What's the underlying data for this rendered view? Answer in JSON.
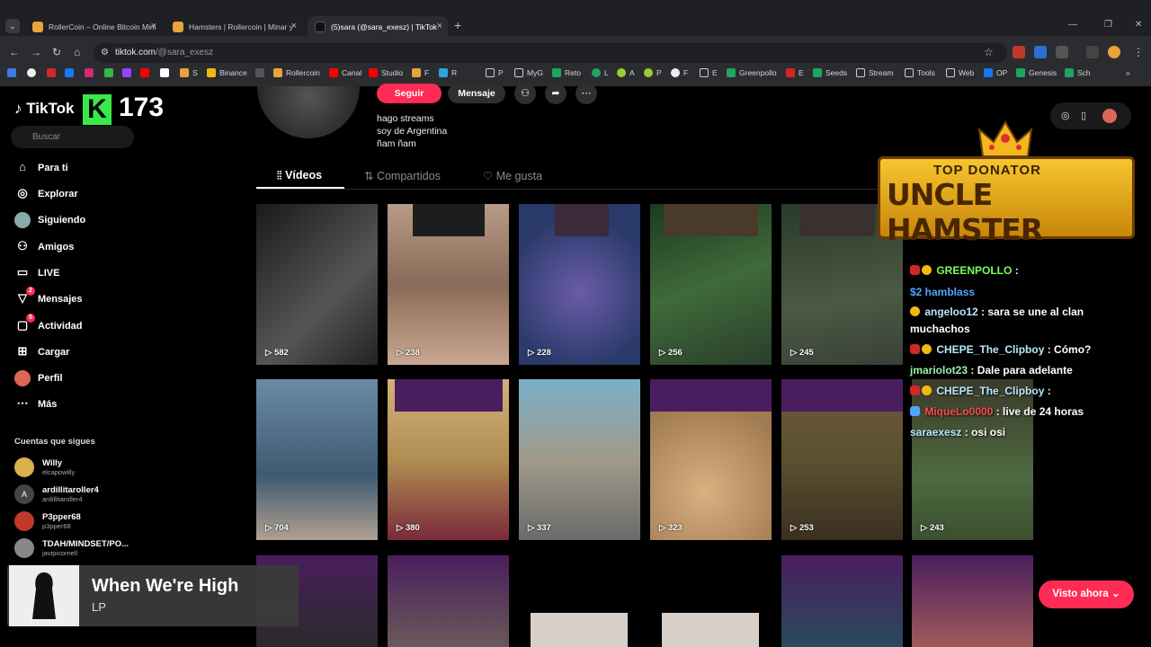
{
  "browser": {
    "tabs": [
      {
        "title": "RollerCoin – Online Bitcoin Mini",
        "color": "#e7a33c"
      },
      {
        "title": "Hamsters | Rollercoin | Minar y",
        "color": "#e7a33c"
      },
      {
        "title": "(5)sara (@sara_exesz) | TikTok",
        "color": "#111111"
      }
    ],
    "url_host": "tiktok.com",
    "url_path": "/@sara_exesz",
    "bookmarks": [
      "Binance",
      "Rollercoin",
      "Canal",
      "Studio",
      "F",
      "R",
      "P",
      "MyG",
      "Reto",
      "L",
      "A",
      "P",
      "F",
      "E",
      "Greenpollo",
      "E",
      "Seeds",
      "Stream",
      "Tools",
      "Web",
      "OP",
      "Genesis",
      "Sch"
    ],
    "bookmark_single": [
      "S"
    ]
  },
  "sidebar": {
    "brand": "TikTok",
    "kick_count": "173",
    "search_placeholder": "Buscar",
    "nav": [
      {
        "label": "Para ti",
        "icon": "home-icon"
      },
      {
        "label": "Explorar",
        "icon": "compass-icon"
      },
      {
        "label": "Siguiendo",
        "icon": "following-avatar-icon"
      },
      {
        "label": "Amigos",
        "icon": "friends-icon"
      },
      {
        "label": "LIVE",
        "icon": "live-icon"
      },
      {
        "label": "Mensajes",
        "icon": "send-icon",
        "badge": "2"
      },
      {
        "label": "Actividad",
        "icon": "activity-icon",
        "badge": "5"
      },
      {
        "label": "Cargar",
        "icon": "upload-icon"
      },
      {
        "label": "Perfil",
        "icon": "profile-icon"
      },
      {
        "label": "Más",
        "icon": "more-icon"
      }
    ],
    "following_title": "Cuentas que sigues",
    "following": [
      {
        "name": "Willy",
        "handle": "elcapowilly"
      },
      {
        "name": "ardillitaroller4",
        "handle": "ardillitaroller4",
        "initial": "A"
      },
      {
        "name": "P3pper68",
        "handle": "p3pper68"
      },
      {
        "name": "TDAH/MINDSET/PO...",
        "handle": "javipicornell"
      }
    ]
  },
  "profile": {
    "follow_label": "Seguir",
    "message_label": "Mensaje",
    "bio": [
      "hago streams",
      "soy de Argentina",
      "ñam ñam"
    ],
    "tabs": [
      "Vídeos",
      "Compartidos",
      "Me gusta"
    ]
  },
  "videos": [
    {
      "views": "582",
      "bg": "#2a2a2a"
    },
    {
      "views": "238",
      "bg": "#8a6a58"
    },
    {
      "views": "228",
      "bg": "#3b4a7a"
    },
    {
      "views": "256",
      "bg": "#2f4a2e"
    },
    {
      "views": "245",
      "bg": "#3c4a38"
    },
    {
      "views": "704",
      "bg": "#4a6c8a"
    },
    {
      "views": "380",
      "bg": "#b08e52"
    },
    {
      "views": "337",
      "bg": "#8c8a82"
    },
    {
      "views": "323",
      "bg": "#c9a06a"
    },
    {
      "views": "253",
      "bg": "#5c5030"
    },
    {
      "views": "243",
      "bg": "#4e6a40"
    }
  ],
  "overlay": {
    "banner_top": "TOP DONATOR",
    "banner_main": "UNCLE HAMSTER",
    "chat": [
      {
        "user": "GREENPOLLO",
        "msg": ":",
        "cls": "u-g"
      },
      {
        "user": "$2 hamblass",
        "msg": "",
        "cls": "u-b"
      },
      {
        "user": "angeloo12",
        "msg": ": sara se une al clan",
        "cls": "u-l"
      },
      {
        "user": "",
        "msg": "muchachos",
        "cls": ""
      },
      {
        "user": "CHEPE_The_Clipboy",
        "msg": ": Cómo?",
        "cls": "u-l"
      },
      {
        "user": "jmariolot23",
        "msg": ": Dale para adelante",
        "cls": "u-lg"
      },
      {
        "user": "CHEPE_The_Clipboy",
        "msg": ":",
        "cls": "u-l"
      },
      {
        "user": "MiqueLo0000",
        "msg": ": live de 24 horas",
        "cls": "u-r"
      },
      {
        "user": "saraexesz",
        "msg": ": osi osi",
        "cls": "u-l"
      }
    ]
  },
  "player": {
    "title": "When We're High",
    "artist": "LP"
  },
  "visto_label": "Visto ahora"
}
